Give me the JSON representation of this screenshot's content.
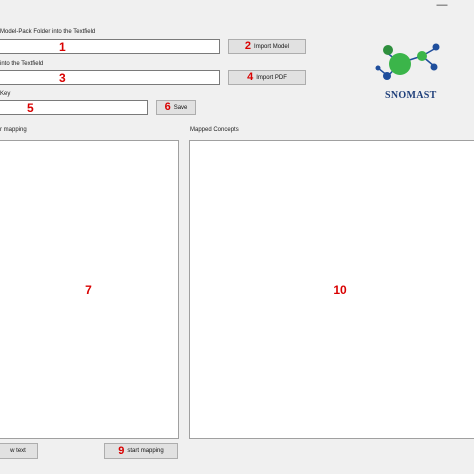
{
  "window": {
    "minimize_glyph": "—"
  },
  "row1": {
    "label": "Model-Pack Folder into the Textfield",
    "value": "",
    "marker": "1",
    "button_marker": "2",
    "button_label": "Import Model"
  },
  "row2": {
    "label": "into the Textfield",
    "value": "",
    "marker": "3",
    "button_marker": "4",
    "button_label": "Import PDF"
  },
  "row3": {
    "label": "Key",
    "value": "",
    "marker": "5",
    "button_marker": "6",
    "button_label": "Save"
  },
  "logo": {
    "text": "SNOMAST",
    "colors": {
      "green": "#3bb54a",
      "blue": "#1f4e9c",
      "text": "#1f3f7a"
    }
  },
  "left_panel": {
    "label": "r mapping",
    "marker": "7"
  },
  "right_panel": {
    "label": "Mapped Concepts",
    "marker": "10"
  },
  "bottom": {
    "left_button_label": "w text",
    "start_button_marker": "9",
    "start_button_label": "start mapping"
  },
  "colors": {
    "marker": "#d90000",
    "background": "#f0f0f0"
  }
}
